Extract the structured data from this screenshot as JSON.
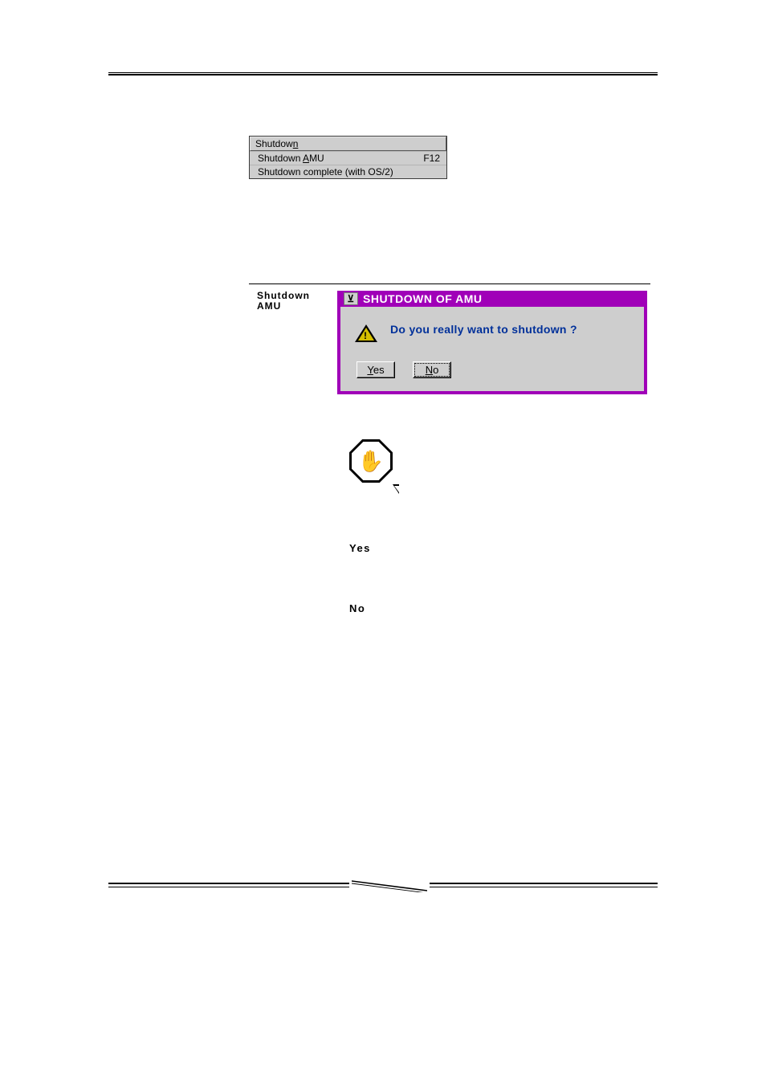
{
  "menu": {
    "header_pre": "Shutdow",
    "header_u": "n",
    "item1_pre": "Shutdown ",
    "item1_u": "A",
    "item1_post": "MU",
    "item1_shortcut": "F12",
    "item2": "Shutdown complete (with OS/2)"
  },
  "section_label_line1": "Shutdown",
  "section_label_line2": "AMU",
  "dialog": {
    "title": "SHUTDOWN OF AMU",
    "sysmenu_glyph": "⊻",
    "warning_glyph": "!",
    "message": "Do you really want to shutdown ?",
    "yes_u": "Y",
    "yes_post": "es",
    "no_u": "N",
    "no_post": "o"
  },
  "stop_glyph": "✋",
  "yes_label": "Yes",
  "no_label": "No"
}
